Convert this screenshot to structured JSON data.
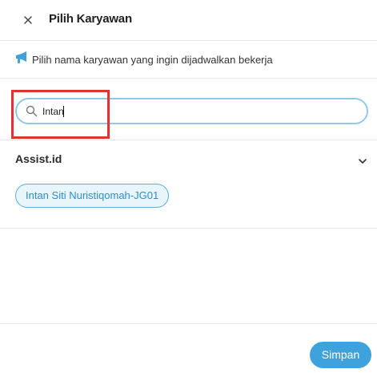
{
  "header": {
    "title": "Pilih Karyawan",
    "close_icon": "close-icon"
  },
  "info": {
    "icon": "megaphone-icon",
    "text": "Pilih nama karyawan yang ingin dijadwalkan bekerja"
  },
  "search": {
    "value": "Intan",
    "icon": "search-icon"
  },
  "group": {
    "title": "Assist.id",
    "chevron_icon": "chevron-down-icon",
    "employees": [
      {
        "label": "Intan Siti Nuristiqomah-JG01"
      }
    ]
  },
  "footer": {
    "save_label": "Simpan"
  },
  "colors": {
    "accent": "#3fa2dd",
    "chip_border": "#5aaee0",
    "chip_bg": "#e9f5fc",
    "highlight": "#e0342d"
  }
}
